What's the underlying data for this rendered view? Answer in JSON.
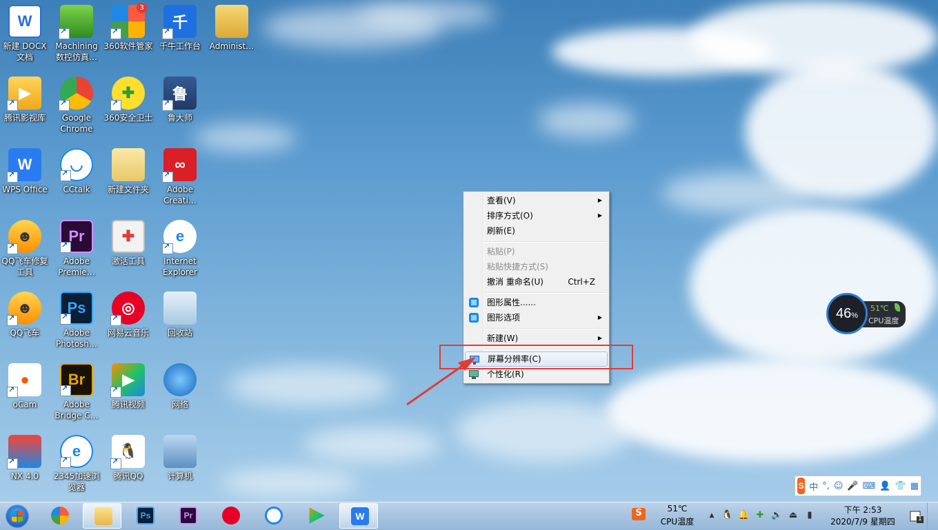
{
  "desktop": {
    "icons": [
      {
        "label": "新建 DOCX\n文档"
      },
      {
        "label": "Machining\n数控仿真…"
      },
      {
        "label": "360软件管家",
        "badge": "3"
      },
      {
        "label": "千牛工作台"
      },
      {
        "label": "Administ…"
      },
      {
        "label": "腾讯影视库"
      },
      {
        "label": "Google\nChrome"
      },
      {
        "label": "360安全卫士"
      },
      {
        "label": "鲁大师"
      },
      {
        "label": "WPS Office"
      },
      {
        "label": "CCtalk"
      },
      {
        "label": "新建文件夹"
      },
      {
        "label": "Adobe\nCreati…"
      },
      {
        "label": "QQ飞车修复\n工具"
      },
      {
        "label": "Adobe\nPremie…"
      },
      {
        "label": "激活工具"
      },
      {
        "label": "Internet\nExplorer"
      },
      {
        "label": "QQ飞车"
      },
      {
        "label": "Adobe\nPhotosh…"
      },
      {
        "label": "网易云音乐"
      },
      {
        "label": "回收站"
      },
      {
        "label": "oCam"
      },
      {
        "label": "Adobe\nBridge C…"
      },
      {
        "label": "腾讯视频"
      },
      {
        "label": "网络"
      },
      {
        "label": "NX 4.0"
      },
      {
        "label": "2345加速浏\n览器"
      },
      {
        "label": "腾讯QQ"
      },
      {
        "label": "计算机"
      }
    ]
  },
  "context_menu": {
    "view": "查看(V)",
    "sort": "排序方式(O)",
    "refresh": "刷新(E)",
    "paste": "粘贴(P)",
    "paste_shortcut": "粘贴快捷方式(S)",
    "undo": "撤消 重命名(U)",
    "undo_shortcut": "Ctrl+Z",
    "graphics_props": "图形属性......",
    "graphics_options": "图形选项",
    "new": "新建(W)",
    "screen_resolution": "屏幕分辨率(C)",
    "personalize": "个性化(R)"
  },
  "cpu_widget": {
    "usage": "46",
    "usage_unit": "%",
    "temp": "51℃",
    "label": "CPU温度"
  },
  "ime": {
    "lang": "中",
    "punct": "°,"
  },
  "taskbar": {
    "cpu_temp": "51℃",
    "cpu_label": "CPU温度",
    "time": "下午 2:53",
    "date": "2020/7/9 星期四",
    "notif_count": "1"
  },
  "colors": {
    "highlight_box": "#e53935",
    "taskbar": "#a8c4e0",
    "menu_bg": "#f0f0f0"
  }
}
